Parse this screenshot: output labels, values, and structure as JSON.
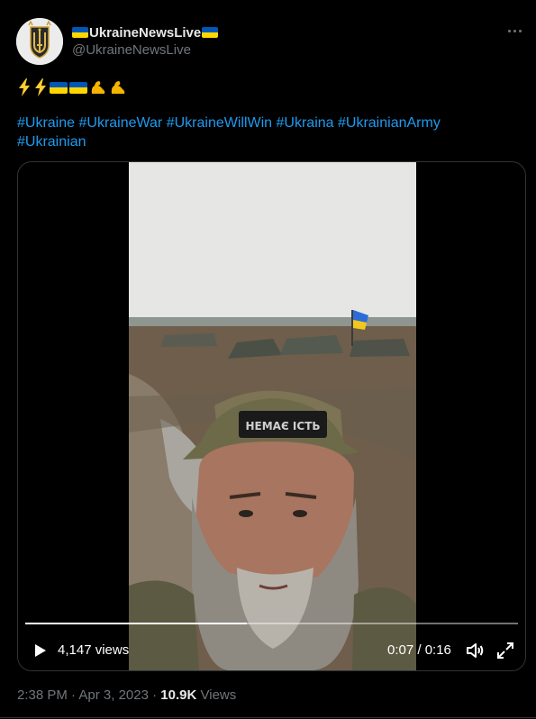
{
  "author": {
    "display_name": "UkraineNewsLive",
    "handle": "@UkraineNewsLive",
    "avatar_icon": "trident-coat-of-arms-icon"
  },
  "tweet": {
    "emoji_text": [
      "lightning-emoji",
      "lightning-emoji",
      "ukraine-flag-emoji",
      "ukraine-flag-emoji",
      "flexed-biceps-emoji",
      "flexed-biceps-emoji"
    ],
    "hashtags": [
      "#Ukraine",
      "#UkraineWar",
      "#UkraineWillWin",
      "#Ukraina",
      "#UkrainianArmy",
      "#Ukrainian"
    ]
  },
  "video": {
    "views_label": "4,147 views",
    "time_label": "0:07 / 0:16",
    "progress": 0.45,
    "patch_text": "НЕМАЄ ІСТЬ"
  },
  "meta": {
    "time": "2:38 PM",
    "separator": "·",
    "date": "Apr 3, 2023",
    "views_count": "10.9K",
    "views_word": "Views"
  },
  "colors": {
    "background": "#000000",
    "link": "#1d9bf0",
    "text_primary": "#e7e9ea",
    "text_secondary": "#71767b",
    "flag_blue": "#0057b7",
    "flag_yellow": "#ffd700",
    "border": "#2f3336"
  }
}
